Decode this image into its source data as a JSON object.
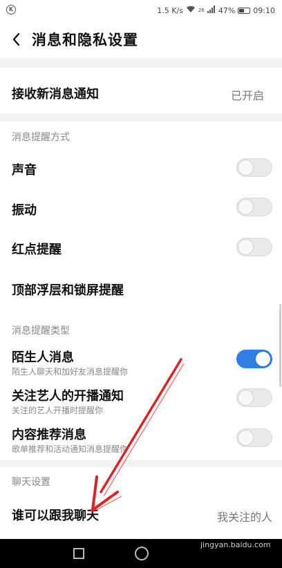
{
  "statusbar": {
    "speed": "1.5 K/s",
    "network": "26",
    "battery": "47%",
    "time": "09:10"
  },
  "header": {
    "title": "消息和隐私设置"
  },
  "notify_row": {
    "label": "接收新消息通知",
    "value": "已开启"
  },
  "section_reminder_method": {
    "title": "消息提醒方式",
    "items": [
      {
        "label": "声音",
        "enabled": false
      },
      {
        "label": "振动",
        "enabled": false
      },
      {
        "label": "红点提醒",
        "enabled": false
      },
      {
        "label": "顶部浮层和锁屏提醒"
      }
    ]
  },
  "section_reminder_type": {
    "title": "消息提醒类型",
    "items": [
      {
        "label": "陌生人消息",
        "sub": "陌生人聊天和加好友消息提醒你",
        "enabled": true
      },
      {
        "label": "关注艺人的开播通知",
        "sub": "关注的艺人开播时提醒你",
        "enabled": false
      },
      {
        "label": "内容推荐消息",
        "sub": "歌单推荐和活动通知消息提醒你",
        "enabled": false
      }
    ]
  },
  "section_chat": {
    "title": "聊天设置",
    "items": [
      {
        "label": "谁可以跟我聊天",
        "value": "我关注的人"
      }
    ]
  },
  "watermark": "jingyan.baidu.com",
  "colors": {
    "accent": "#2f7fe6",
    "annotation_arrow": "#e02020"
  }
}
